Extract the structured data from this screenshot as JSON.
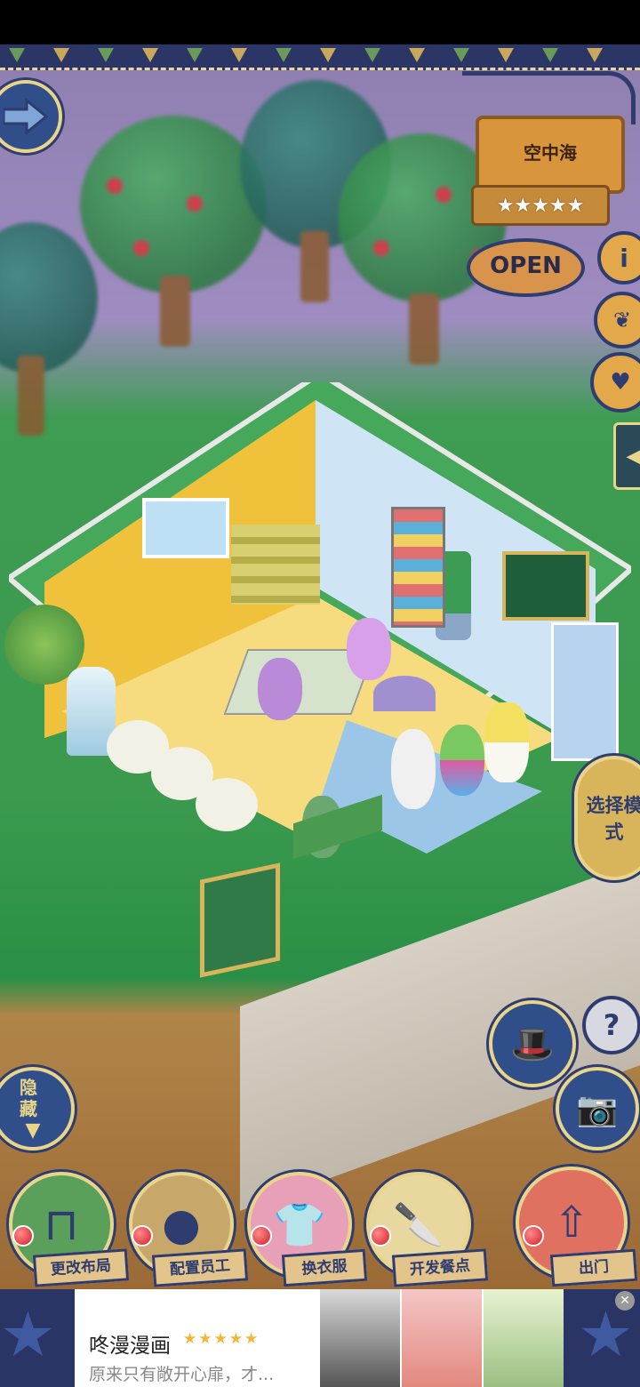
{
  "shop": {
    "name": "空中海",
    "rating_stars": "★★★★★",
    "open_label": "OPEN"
  },
  "side_buttons": {
    "select_mode": "选择模式",
    "hide": "隐藏",
    "help": "?"
  },
  "bottom_menu": [
    {
      "label": "更改布局"
    },
    {
      "label": "配置员工"
    },
    {
      "label": "换衣服"
    },
    {
      "label": "开发餐点"
    },
    {
      "label": "出门"
    }
  ],
  "ad": {
    "title": "咚漫漫画",
    "stars": "★★★★★",
    "description": "原来只有敞开心扉，才..."
  },
  "colors": {
    "navy": "#2f3c70",
    "gold": "#e9d58a",
    "grass": "#3b9a4e",
    "wood": "#d9953b"
  }
}
